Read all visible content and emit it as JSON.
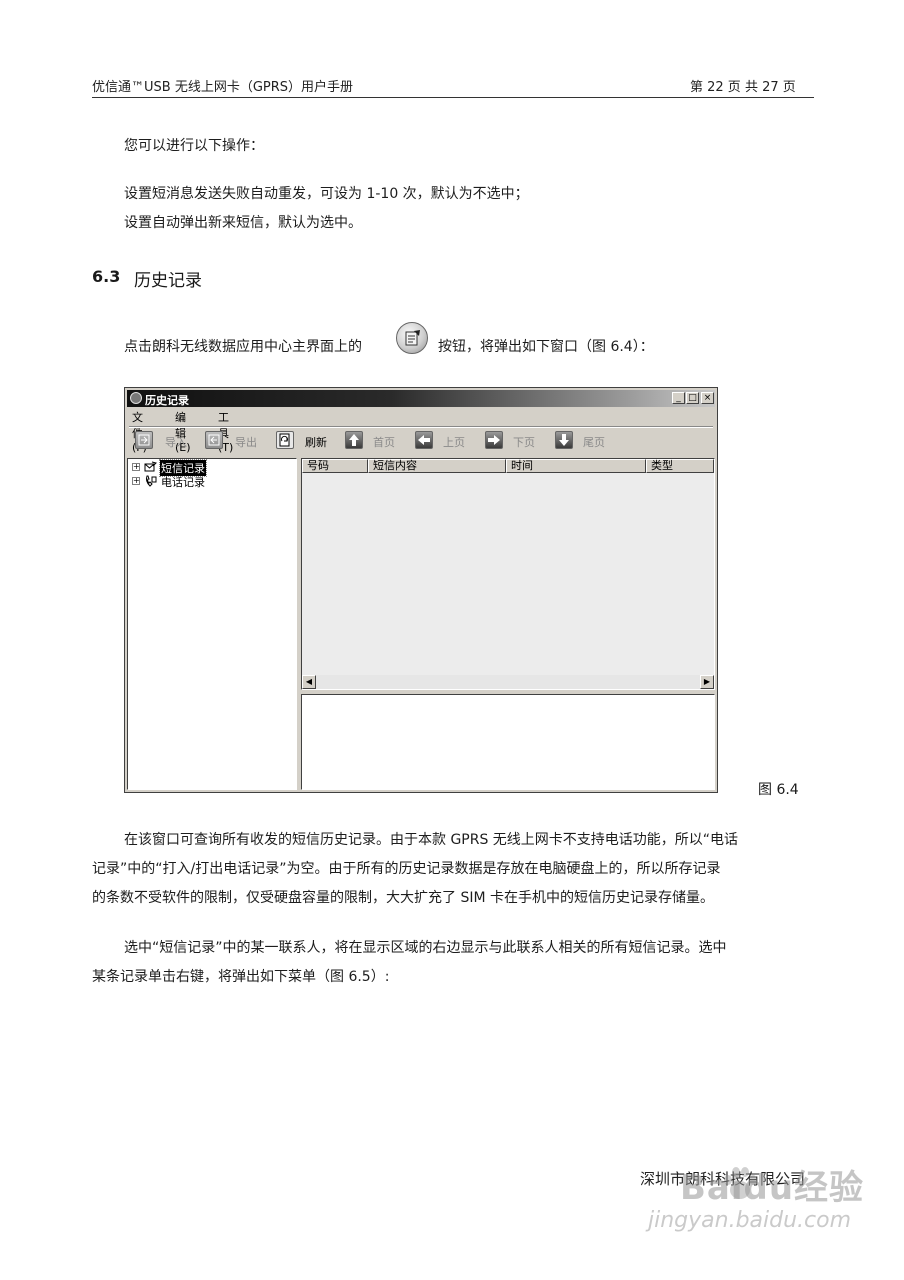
{
  "header": {
    "title": "优信通™USB 无线上网卡（GPRS）用户手册",
    "page": "第 22 页 共 27 页"
  },
  "body": {
    "p1": "您可以进行以下操作：",
    "p2": "设置短消息发送失败自动重发，可设为 1-10 次，默认为不选中；",
    "p3": "设置自动弹出新来短信，默认为选中。",
    "section_no": "6.3",
    "section_title": "历史记录",
    "p4_before": "点击朗科无线数据应用中心主界面上的",
    "p4_after": "按钮，将弹出如下窗口（图 6.4）：",
    "p5_l1": "在该窗口可查询所有收发的短信历史记录。由于本款 GPRS 无线上网卡不支持电话功能，所以“电话",
    "p5_l2": "记录”中的“打入/打出电话记录”为空。由于所有的历史记录数据是存放在电脑硬盘上的，所以所存记录",
    "p5_l3": "的条数不受软件的限制，仅受硬盘容量的限制，大大扩充了 SIM 卡在手机中的短信历史记录存储量。",
    "p6_l1": "选中“短信记录”中的某一联系人，将在显示区域的右边显示与此联系人相关的所有短信记录。选中",
    "p6_l2": "某条记录单击右键，将弹出如下菜单（图 6.5）:"
  },
  "window": {
    "title": "历史记录",
    "controls": [
      "_",
      "□",
      "×"
    ],
    "menu": [
      "文件(F)",
      "编辑(E)",
      "工具(T)"
    ],
    "toolbar": [
      {
        "label": "导入",
        "icon": "import-icon",
        "enabled": false
      },
      {
        "label": "导出",
        "icon": "export-icon",
        "enabled": false
      },
      {
        "label": "刷新",
        "icon": "refresh-icon",
        "enabled": true
      },
      {
        "label": "首页",
        "icon": "arrow-up-icon",
        "enabled": false
      },
      {
        "label": "上页",
        "icon": "arrow-left-icon",
        "enabled": false
      },
      {
        "label": "下页",
        "icon": "arrow-right-icon",
        "enabled": false
      },
      {
        "label": "尾页",
        "icon": "arrow-down-icon",
        "enabled": false
      }
    ],
    "tree": [
      {
        "label": "短信记录",
        "icon": "sms-icon",
        "selected": true
      },
      {
        "label": "电话记录",
        "icon": "phone-icon",
        "selected": false
      }
    ],
    "columns": [
      "号码",
      "短信内容",
      "时间",
      "类型"
    ]
  },
  "caption": "图 6.4",
  "footer": {
    "company": "深圳市朗科科技有限公司",
    "watermark_logo": "Baidu经验",
    "watermark_url": "jingyan.baidu.com"
  }
}
